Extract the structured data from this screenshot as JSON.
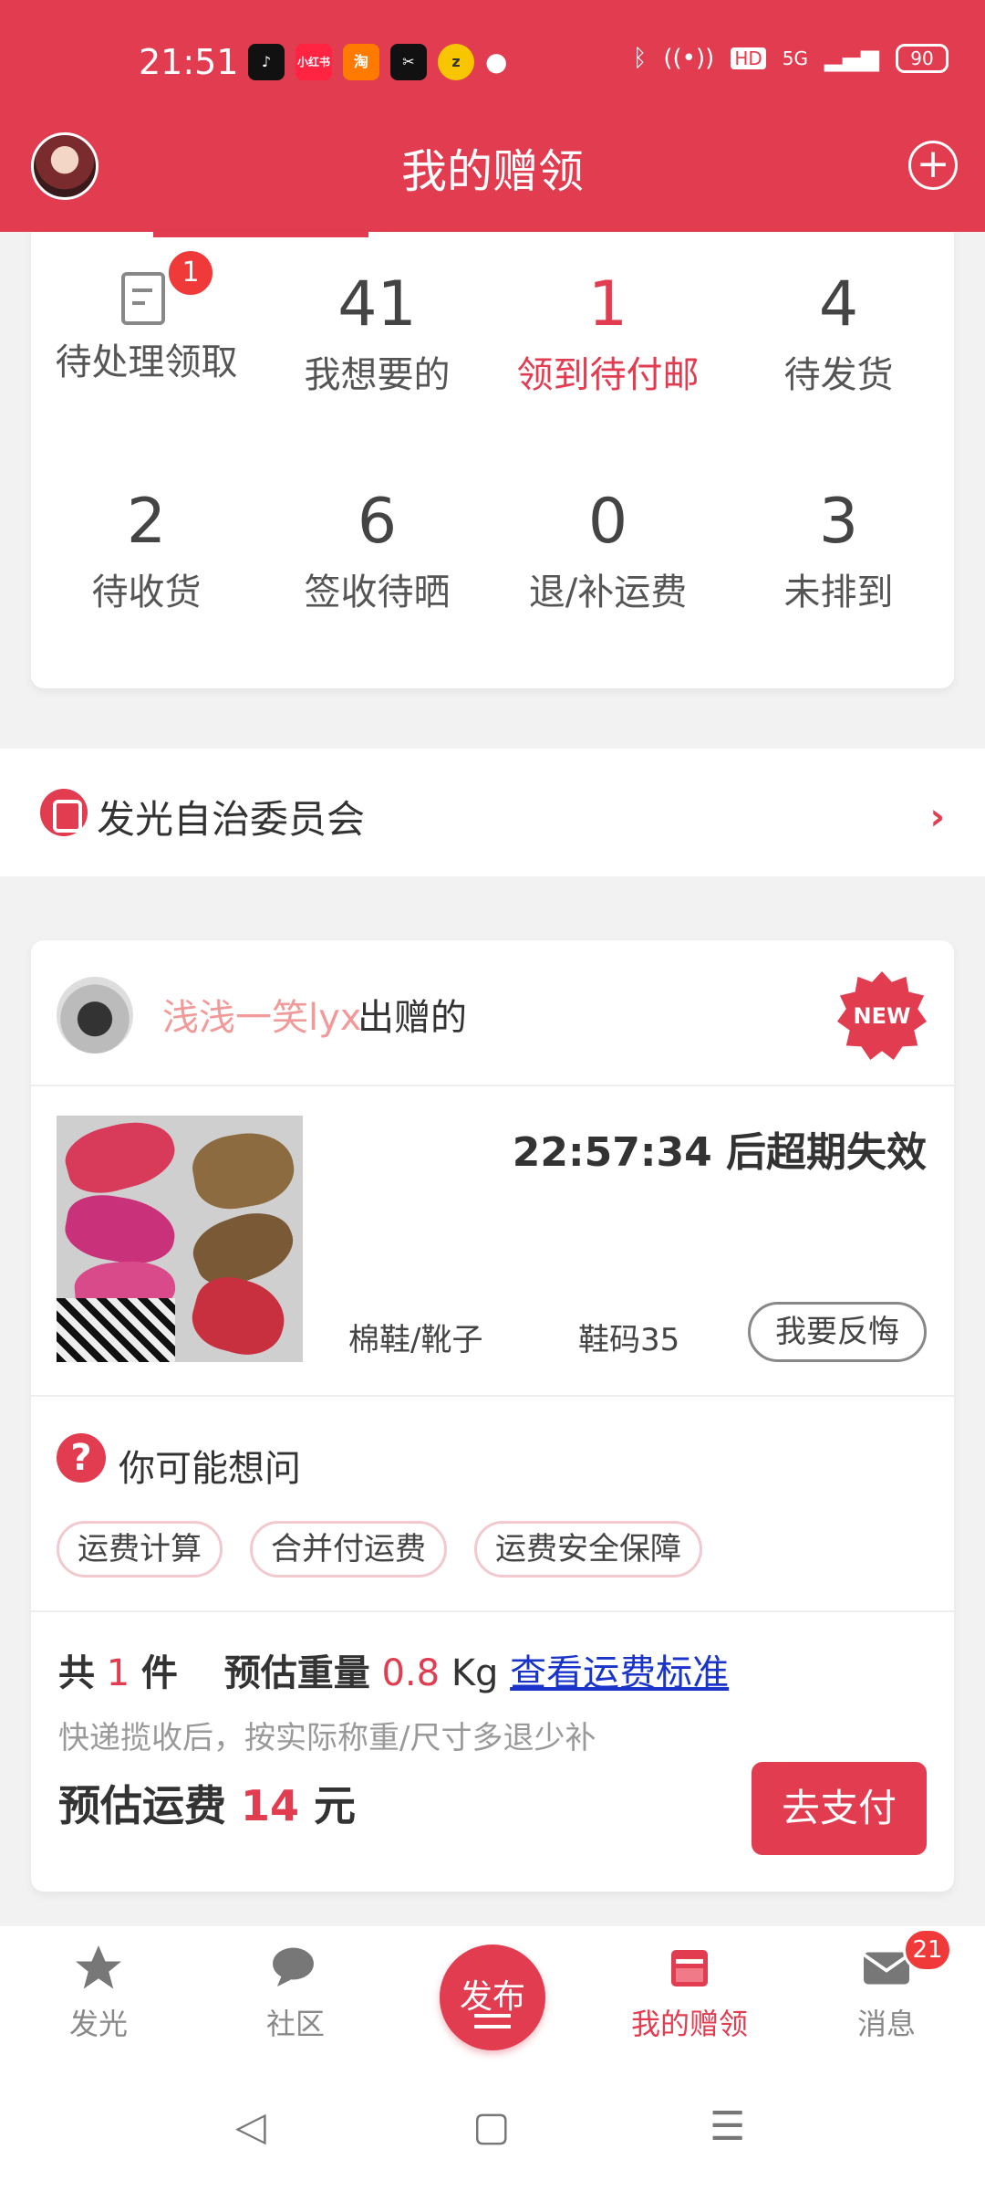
{
  "status_bar": {
    "time": "21:51",
    "apps": [
      {
        "icon": "tiktok-icon",
        "text": "♪",
        "color": "#111111"
      },
      {
        "icon": "xiaohongshu-icon",
        "text": "小红书",
        "color": "#ff2442"
      },
      {
        "icon": "taobao-icon",
        "text": "淘",
        "color": "#ff7a00"
      },
      {
        "icon": "capcut-icon",
        "text": "✂",
        "color": "#111111"
      },
      {
        "icon": "star-app-icon",
        "text": "z",
        "color": "#f7c600"
      }
    ],
    "network_label": "HD",
    "signal_label": "5G",
    "battery": "90"
  },
  "header": {
    "title": "我的赠领",
    "plus_symbol": "+"
  },
  "summary": {
    "pending_badge": "1",
    "stats": [
      {
        "num": "",
        "label": "待处理领取",
        "active": false
      },
      {
        "num": "41",
        "label": "我想要的",
        "active": false
      },
      {
        "num": "1",
        "label": "领到待付邮",
        "active": true
      },
      {
        "num": "4",
        "label": "待发货",
        "active": false
      },
      {
        "num": "2",
        "label": "待收货",
        "active": false
      },
      {
        "num": "6",
        "label": "签收待晒",
        "active": false
      },
      {
        "num": "0",
        "label": "退/补运费",
        "active": false
      },
      {
        "num": "3",
        "label": "未排到",
        "active": false
      }
    ]
  },
  "committee": {
    "label": "发光自治委员会",
    "chevron": "›"
  },
  "order": {
    "giver_name": "浅浅一笑lyx",
    "giver_suffix": "出赠的",
    "new_badge": "NEW",
    "expire_text": "22:57:34 后超期失效",
    "item_category": "棉鞋/靴子",
    "item_size": "鞋码35",
    "regret_button": "我要反悔",
    "faq_icon": "?",
    "faq_title": "你可能想问",
    "faq_chips": [
      "运费计算",
      "合并付运费",
      "运费安全保障"
    ],
    "ship_prefix": "共",
    "ship_count": "1",
    "ship_unit": "件",
    "weight_label": "预估重量",
    "weight_value": "0.8",
    "weight_unit": "Kg",
    "standard_link": "查看运费标准",
    "note": "快递揽收后，按实际称重/尺寸多退少补",
    "fee_label": "预估运费",
    "fee_value": "14",
    "fee_unit": "元",
    "pay_button": "去支付"
  },
  "bottom_nav": {
    "items": [
      {
        "label": "发光",
        "active": false
      },
      {
        "label": "社区",
        "active": false
      },
      {
        "label": "我的赠领",
        "active": true
      },
      {
        "label": "消息",
        "active": false
      }
    ],
    "publish_label": "发布",
    "message_badge": "21"
  },
  "system_nav": {
    "back": "◁",
    "home": "▢",
    "menu": "☰"
  },
  "colors": {
    "brand": "#e23c50",
    "link": "#1a33c9"
  }
}
